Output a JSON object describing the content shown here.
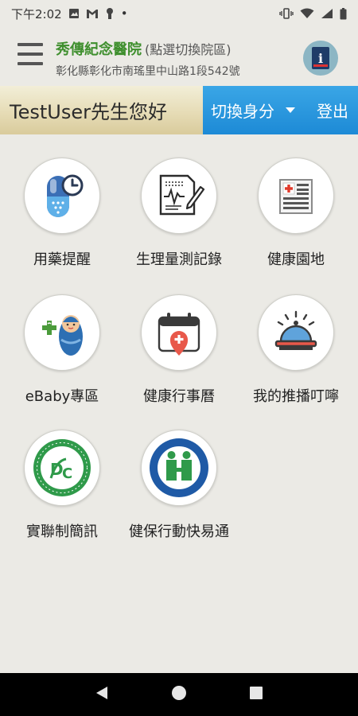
{
  "status_bar": {
    "time": "下午2:02",
    "dot": "•"
  },
  "header": {
    "hospital_name": "秀傳紀念醫院",
    "hospital_hint": "(點選切換院區)",
    "address": "彰化縣彰化市南瑤里中山路1段542號",
    "info_glyph": "i"
  },
  "user_bar": {
    "greeting": "TestUser先生您好",
    "switch_label": "切換身分",
    "logout_label": "登出"
  },
  "tiles": [
    {
      "label": "用藥提醒",
      "icon": "medicine-reminder-icon"
    },
    {
      "label": "生理量測記錄",
      "icon": "measurement-record-icon"
    },
    {
      "label": "健康園地",
      "icon": "health-news-icon"
    },
    {
      "label": "eBaby專區",
      "icon": "ebaby-icon"
    },
    {
      "label": "健康行事曆",
      "icon": "health-calendar-icon"
    },
    {
      "label": "我的推播叮嚀",
      "icon": "push-notification-bell-icon"
    },
    {
      "label": "實聯制簡訊",
      "icon": "real-name-sms-icon"
    },
    {
      "label": "健保行動快易通",
      "icon": "nhi-express-icon"
    }
  ],
  "colors": {
    "accent_blue": "#1d8ad6",
    "hospital_green": "#3f8f2e",
    "background": "#ebeae5"
  }
}
